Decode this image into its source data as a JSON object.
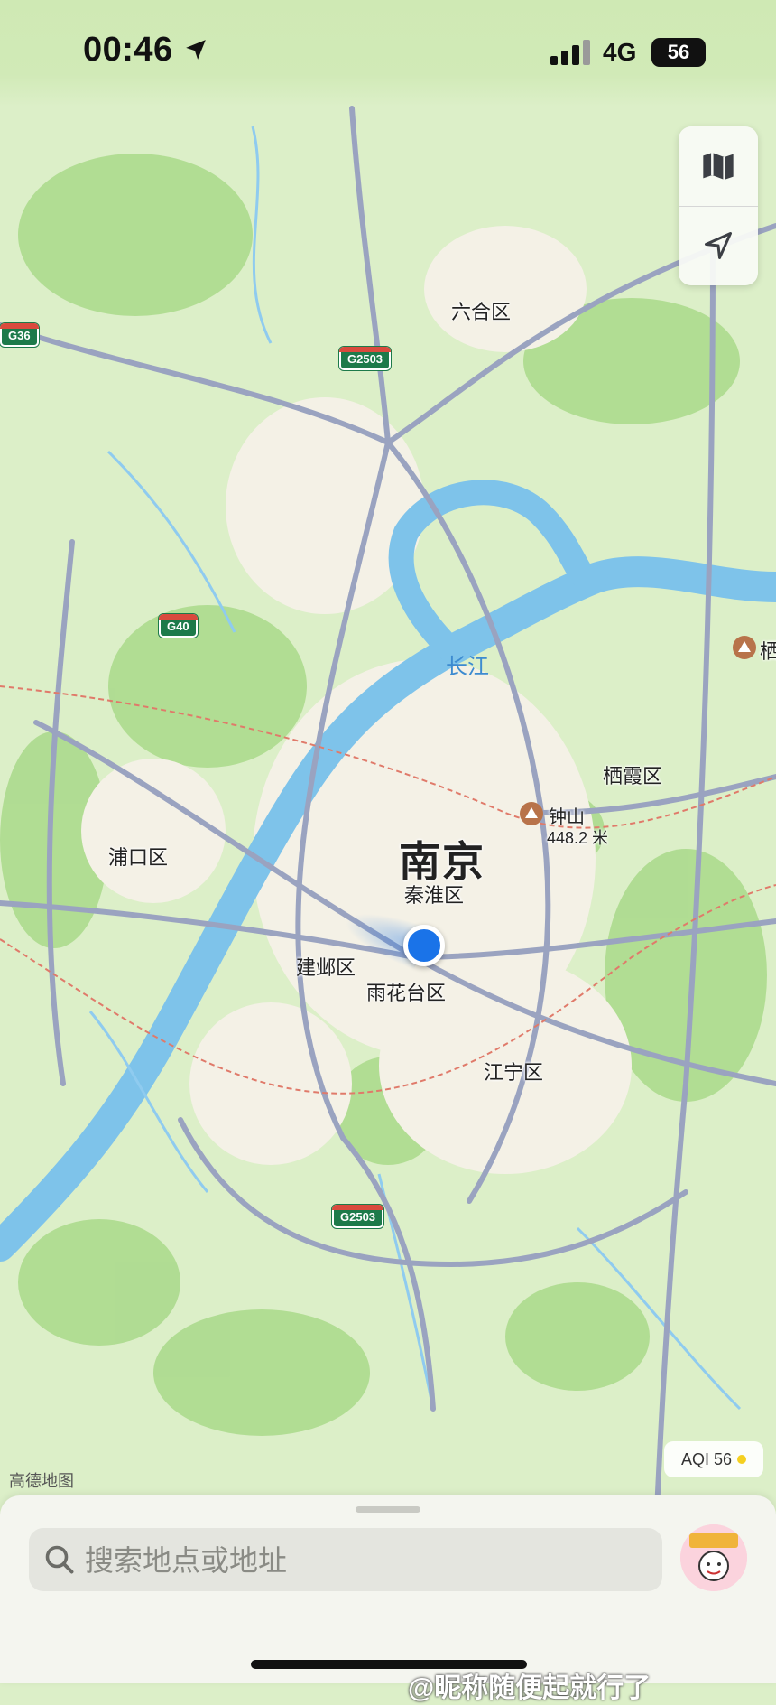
{
  "status_bar": {
    "time": "00:46",
    "network": "4G",
    "battery": "56"
  },
  "map": {
    "districts": {
      "liuhe": "六合区",
      "qixia": "栖霞区",
      "pukou": "浦口区",
      "qinhuai": "秦淮区",
      "jianye": "建邺区",
      "yuhuatai": "雨花台区",
      "jiangning": "江宁区"
    },
    "city": "南京",
    "river": "长江",
    "peak_name": "钟山",
    "peak_elevation": "448.2 米",
    "peak_edge_label": "栖",
    "highways": {
      "g36": "G36",
      "g2503_north": "G2503",
      "g40": "G40",
      "g2503_south": "G2503"
    },
    "attribution": "高德地图",
    "aqi_label": "AQI 56"
  },
  "bottom_sheet": {
    "search_placeholder": "搜索地点或地址"
  },
  "watermark": "@昵称随便起就行了",
  "colors": {
    "land": "#dcefc8",
    "park": "#a9d98a",
    "urban": "#f4f1e6",
    "water": "#7ec3ea",
    "road": "#9aa3c0",
    "location": "#1a73e8"
  }
}
